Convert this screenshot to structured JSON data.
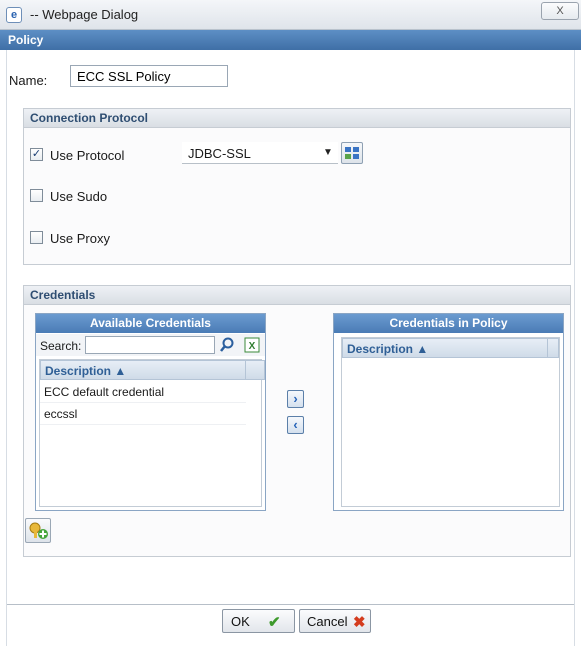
{
  "window": {
    "title": "-- Webpage Dialog",
    "close_label": "X",
    "header": "Policy"
  },
  "name": {
    "label": "Name:",
    "value": "ECC SSL Policy"
  },
  "connection": {
    "title": "Connection Protocol",
    "use_protocol": {
      "label": "Use Protocol",
      "checked": true
    },
    "protocol_select": {
      "value": "JDBC-SSL"
    },
    "use_sudo": {
      "label": "Use Sudo",
      "checked": false
    },
    "use_proxy": {
      "label": "Use Proxy",
      "checked": false
    }
  },
  "credentials": {
    "title": "Credentials",
    "available": {
      "title": "Available Credentials",
      "search_label": "Search:",
      "search_value": "",
      "column": "Description ▲",
      "rows": [
        "ECC default credential",
        "eccssl"
      ]
    },
    "in_policy": {
      "title": "Credentials in Policy",
      "column": "Description ▲",
      "rows": []
    }
  },
  "buttons": {
    "ok": "OK",
    "cancel": "Cancel"
  },
  "colors": {
    "header": "#4a7bb5",
    "ok_check": "#3e9a2c",
    "cancel_x": "#d43c1e"
  },
  "icons": [
    "ie-page-icon",
    "protocol-settings-icon",
    "search-icon",
    "export-excel-icon",
    "move-right-icon",
    "move-left-icon",
    "add-credential-icon",
    "check-icon",
    "x-icon"
  ]
}
